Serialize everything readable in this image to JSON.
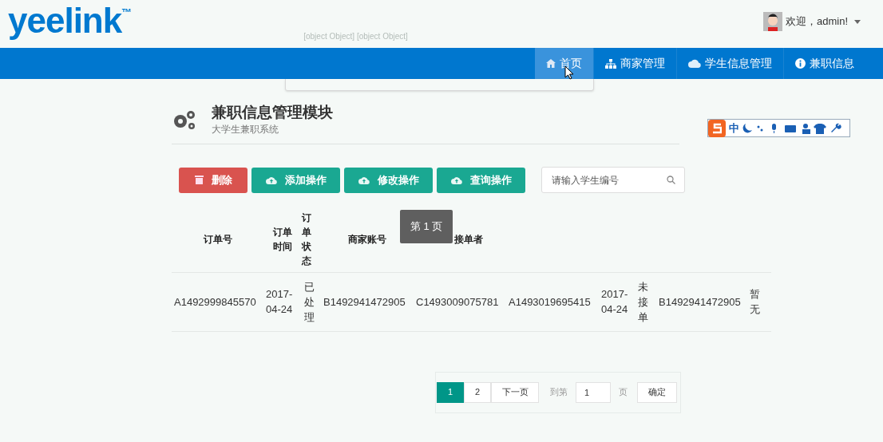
{
  "logo": {
    "text": "yeelink",
    "mark": "™"
  },
  "placeholder_text": "[object Object] [object Object]",
  "user": {
    "greeting": "欢迎，admin!"
  },
  "nav": [
    {
      "label": "首页",
      "kind": "home",
      "selected": true
    },
    {
      "label": "商家管理",
      "kind": "sitemap",
      "selected": false
    },
    {
      "label": "学生信息管理",
      "kind": "cloud",
      "selected": false
    },
    {
      "label": "兼职信息",
      "kind": "info",
      "selected": false
    }
  ],
  "module": {
    "title": "兼职信息管理模块",
    "subtitle": "大学生兼职系统"
  },
  "ime_toolbar": {
    "label": "中"
  },
  "actions": [
    {
      "label": "删除",
      "kind": "danger"
    },
    {
      "label": "添加操作",
      "kind": "primary"
    },
    {
      "label": "修改操作",
      "kind": "primary"
    },
    {
      "label": "查询操作",
      "kind": "primary"
    }
  ],
  "search": {
    "placeholder": "请输入学生编号"
  },
  "table": {
    "columns": [
      "订单号",
      "订单时间",
      "订单状态",
      "商家账号",
      "接单者"
    ],
    "rows": [
      [
        "A1492999845570",
        "2017-04-24",
        "已处理",
        "B1492941472905",
        "C1493009075781",
        "A1493019695415",
        "2017-04-24",
        "未接单",
        "B1492941472905",
        "暂无"
      ]
    ]
  },
  "tooltip": "第 1 页",
  "pagination": {
    "pages": [
      {
        "label": "1",
        "selected": true
      },
      {
        "label": "2",
        "selected": false
      }
    ],
    "next": "下一页",
    "goto_label": "到第",
    "goto_value": "1",
    "page_unit": "页",
    "confirm": "确定"
  }
}
